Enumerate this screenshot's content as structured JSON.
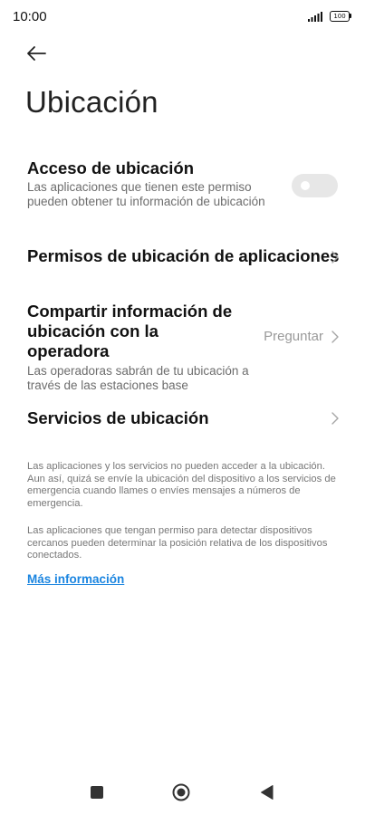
{
  "status_bar": {
    "time": "10:00",
    "battery": "100"
  },
  "page": {
    "title": "Ubicación"
  },
  "settings": {
    "location_access": {
      "title": "Acceso de ubicación",
      "subtitle": "Las aplicaciones que tienen este permiso pueden obtener tu información de ubicación",
      "toggle_on": false
    },
    "app_permissions": {
      "title": "Permisos de ubicación de aplicaciones"
    },
    "carrier_sharing": {
      "title": "Compartir información de ubicación con la operadora",
      "subtitle": "Las operadoras sabrán de tu ubicación a través de las estaciones base",
      "value": "Preguntar"
    },
    "location_services": {
      "title": "Servicios de ubicación"
    }
  },
  "footer": {
    "paragraph_1": "Las aplicaciones y los servicios no pueden acceder a la ubicación. Aun así, quizá se envíe la ubicación del dispositivo a los servicios de emergencia cuando llames o envíes mensajes a números de emergencia.",
    "paragraph_2": "Las aplicaciones que tengan permiso para detectar dispositivos cercanos pueden determinar la posición relativa de los dispositivos conectados.",
    "link": "Más información"
  },
  "colors": {
    "link": "#1b85e0",
    "toggle_off": "#e7e7e7",
    "secondary_text": "#6d6d6d"
  }
}
